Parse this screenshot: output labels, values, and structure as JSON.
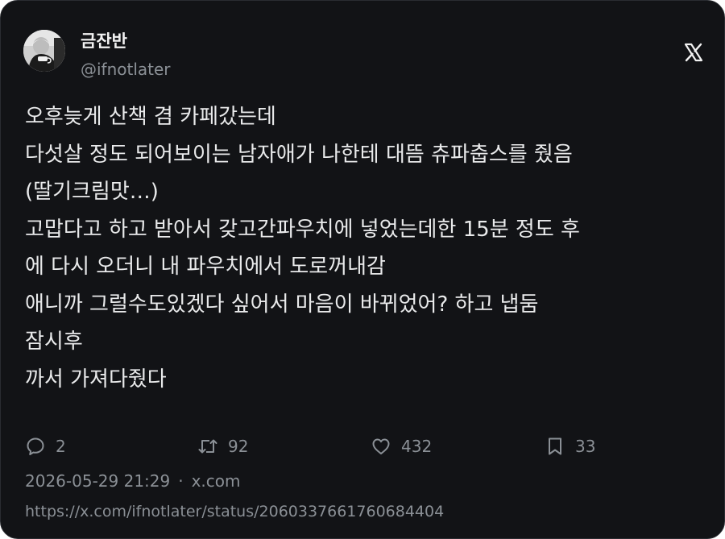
{
  "author": {
    "display_name": "금잔반",
    "handle": "@ifnotlater",
    "avatar_icon": "avatar-photo"
  },
  "brand": {
    "logo_icon": "x-logo-icon",
    "logo_color": "#f2f2f2"
  },
  "tweet": {
    "lines": [
      "오후늦게 산책 겸 카페갔는데",
      "다섯살 정도 되어보이는 남자애가 나한테 대뜸 츄파춥스를 줬음",
      "(딸기크림맛…)",
      "고맙다고 하고 받아서 갖고간파우치에 넣었는데한 15분 정도 후",
      "에 다시 오더니 내 파우치에서 도로꺼내감",
      "애니까 그럴수도있겠다 싶어서 마음이 바뀌었어? 하고 냅둠",
      "잠시후",
      "까서 가져다줬다"
    ]
  },
  "actions": {
    "reply": {
      "icon": "reply-icon",
      "count": "2"
    },
    "retweet": {
      "icon": "retweet-icon",
      "count": "92"
    },
    "like": {
      "icon": "heart-icon",
      "count": "432"
    },
    "bookmark": {
      "icon": "bookmark-icon",
      "count": "33"
    }
  },
  "meta": {
    "timestamp": "2026-05-29 21:29",
    "separator": "·",
    "source": "x.com"
  },
  "status_url": "https://x.com/ifnotlater/status/2060337661760684404",
  "colors": {
    "background": "#121316",
    "text": "#e9eaeb",
    "muted": "#8b9096"
  }
}
